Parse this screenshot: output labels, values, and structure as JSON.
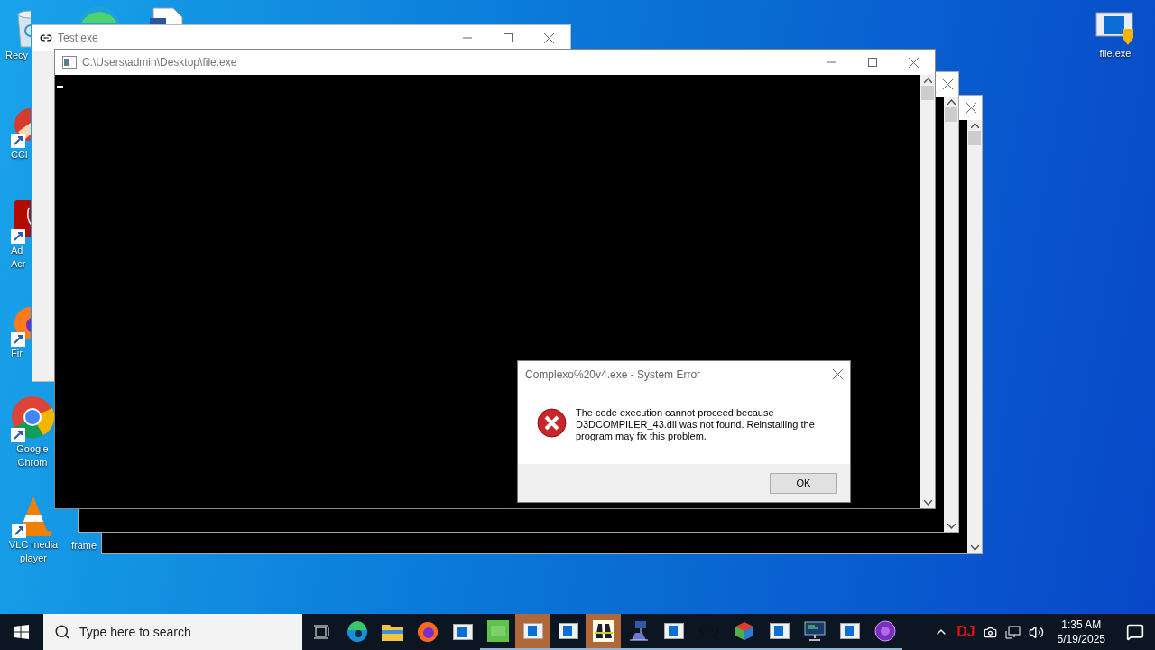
{
  "desktop_icons": [
    {
      "kind": "recycle",
      "lines": [
        "Recy"
      ]
    },
    {
      "kind": "edge"
    },
    {
      "kind": "document"
    },
    {
      "kind": "ccleaner",
      "lines": [
        "CCl"
      ]
    },
    {
      "kind": "acrobat",
      "lines": [
        "Ad",
        "Acr"
      ]
    },
    {
      "kind": "firefox",
      "lines": [
        "Fir"
      ]
    },
    {
      "kind": "chrome",
      "lines": [
        "Google",
        "Chrom"
      ]
    },
    {
      "kind": "vlc",
      "lines": [
        "VLC media",
        "player"
      ]
    },
    {
      "kind": "frame",
      "lines": [
        "frame"
      ]
    },
    {
      "kind": "fileexe",
      "lines": [
        "file.exe"
      ]
    }
  ],
  "windows": [
    {
      "kind": "link",
      "title": "Test exe"
    },
    {
      "kind": "console_back2"
    },
    {
      "kind": "console_back"
    },
    {
      "kind": "console",
      "title": "C:\\Users\\admin\\Desktop\\file.exe"
    }
  ],
  "dialog": {
    "title": "Complexo%20v4.exe - System Error",
    "message": "The code execution cannot proceed because D3DCOMPILER_43.dll was not found. Reinstalling the program may fix this problem.",
    "button": "OK"
  },
  "taskbar": {
    "search": {
      "placeholder": "Type here to search"
    },
    "apps": [
      {
        "kind": "taskview",
        "selected": false,
        "running": false
      },
      {
        "kind": "edge",
        "selected": false,
        "running": false
      },
      {
        "kind": "folder",
        "selected": false,
        "running": false
      },
      {
        "kind": "firefox",
        "selected": false,
        "running": false
      },
      {
        "kind": "window",
        "selected": false,
        "running": false
      },
      {
        "kind": "green",
        "selected": false,
        "running": true
      },
      {
        "kind": "window",
        "selected": true,
        "running": true
      },
      {
        "kind": "window",
        "selected": false,
        "running": true
      },
      {
        "kind": "binoculars",
        "selected": true,
        "running": true
      },
      {
        "kind": "network",
        "selected": false,
        "running": true
      },
      {
        "kind": "window",
        "selected": false,
        "running": true
      },
      {
        "kind": "link",
        "selected": false,
        "running": true
      },
      {
        "kind": "cube",
        "selected": false,
        "running": true
      },
      {
        "kind": "window",
        "selected": false,
        "running": true
      },
      {
        "kind": "monitor",
        "selected": false,
        "running": true
      },
      {
        "kind": "window",
        "selected": false,
        "running": true
      },
      {
        "kind": "purple",
        "selected": false,
        "running": true
      }
    ],
    "tray_badge": "DJ",
    "time": "1:35 AM",
    "date": "5/19/2025"
  }
}
